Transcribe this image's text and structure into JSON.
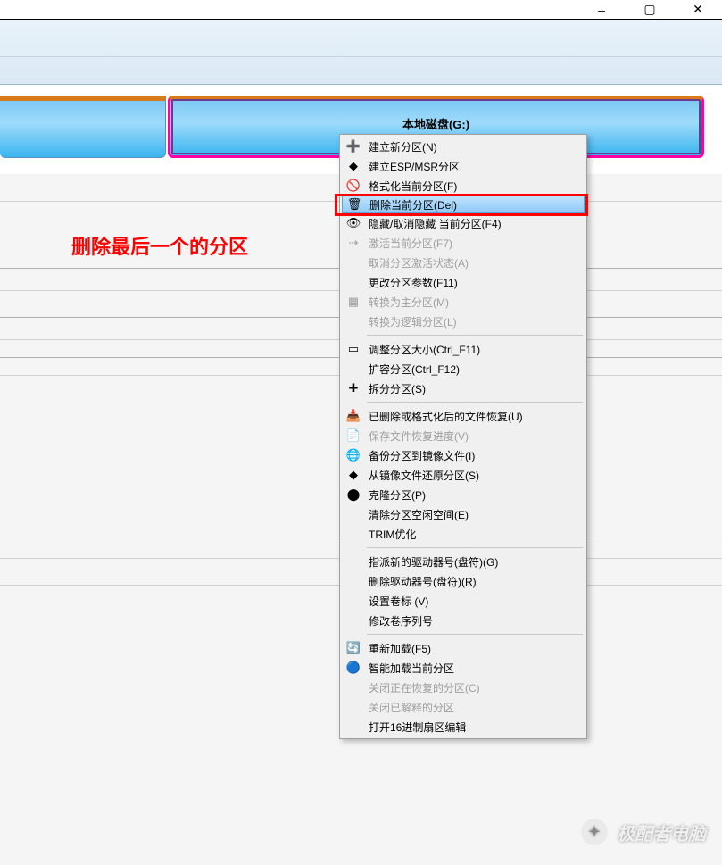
{
  "window": {
    "min_tip": "–",
    "max_tip": "▢",
    "close_tip": "✕"
  },
  "disk": {
    "selected_label": "本地磁盘(G:)"
  },
  "annotation": "删除最后一个的分区",
  "menu": {
    "items": [
      {
        "id": "new-partition",
        "icon": "➕",
        "label": "建立新分区(N)",
        "enabled": true
      },
      {
        "id": "esp-msr",
        "icon": "◆",
        "label": "建立ESP/MSR分区",
        "enabled": true
      },
      {
        "id": "format",
        "icon": "🚫",
        "label": "格式化当前分区(F)",
        "enabled": true
      },
      {
        "id": "delete",
        "icon": "🗑",
        "label": "删除当前分区(Del)",
        "enabled": true,
        "highlighted": true
      },
      {
        "id": "hide",
        "icon": "👁",
        "label": "隐藏/取消隐藏 当前分区(F4)",
        "enabled": true
      },
      {
        "id": "activate",
        "icon": "⇢",
        "label": "激活当前分区(F7)",
        "enabled": false
      },
      {
        "id": "deactivate",
        "icon": "",
        "label": "取消分区激活状态(A)",
        "enabled": false
      },
      {
        "id": "change-params",
        "icon": "",
        "label": "更改分区参数(F11)",
        "enabled": true
      },
      {
        "id": "to-primary",
        "icon": "▦",
        "label": "转换为主分区(M)",
        "enabled": false
      },
      {
        "id": "to-logical",
        "icon": "",
        "label": "转换为逻辑分区(L)",
        "enabled": false
      },
      "sep",
      {
        "id": "resize",
        "icon": "▭",
        "label": "调整分区大小(Ctrl_F11)",
        "enabled": true
      },
      {
        "id": "extend",
        "icon": "",
        "label": "扩容分区(Ctrl_F12)",
        "enabled": true
      },
      {
        "id": "split",
        "icon": "✚",
        "label": "拆分分区(S)",
        "enabled": true
      },
      "sep",
      {
        "id": "recover-files",
        "icon": "📥",
        "label": "已删除或格式化后的文件恢复(U)",
        "enabled": true
      },
      {
        "id": "save-progress",
        "icon": "📄",
        "label": "保存文件恢复进度(V)",
        "enabled": false
      },
      {
        "id": "backup-image",
        "icon": "🌐",
        "label": "备份分区到镜像文件(I)",
        "enabled": true
      },
      {
        "id": "restore-image",
        "icon": "◆",
        "label": "从镜像文件还原分区(S)",
        "enabled": true
      },
      {
        "id": "clone",
        "icon": "⬤",
        "label": "克隆分区(P)",
        "enabled": true
      },
      {
        "id": "wipe-free",
        "icon": "",
        "label": "清除分区空闲空间(E)",
        "enabled": true
      },
      {
        "id": "trim",
        "icon": "",
        "label": "TRIM优化",
        "enabled": true
      },
      "sep",
      {
        "id": "assign-letter",
        "icon": "",
        "label": "指派新的驱动器号(盘符)(G)",
        "enabled": true
      },
      {
        "id": "remove-letter",
        "icon": "",
        "label": "删除驱动器号(盘符)(R)",
        "enabled": true
      },
      {
        "id": "set-volume-label",
        "icon": "",
        "label": "设置卷标 (V)",
        "enabled": true
      },
      {
        "id": "modify-serial",
        "icon": "",
        "label": "修改卷序列号",
        "enabled": true
      },
      "sep",
      {
        "id": "reload",
        "icon": "🔄",
        "label": "重新加载(F5)",
        "enabled": true
      },
      {
        "id": "smart-load",
        "icon": "🔵",
        "label": "智能加载当前分区",
        "enabled": true
      },
      {
        "id": "close-recovering",
        "icon": "",
        "label": "关闭正在恢复的分区(C)",
        "enabled": false
      },
      {
        "id": "close-parsed",
        "icon": "",
        "label": "关闭已解释的分区",
        "enabled": false
      },
      {
        "id": "hex-editor",
        "icon": "",
        "label": "打开16进制扇区编辑",
        "enabled": true
      }
    ]
  },
  "watermark": {
    "text": "极配者电脑"
  }
}
